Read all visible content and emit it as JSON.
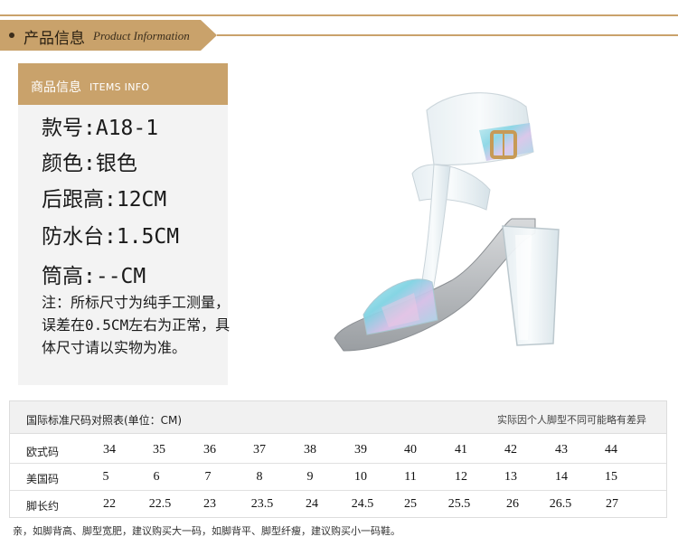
{
  "header": {
    "title_cn": "产品信息",
    "title_en": "Product Information"
  },
  "info_panel": {
    "title_cn": "商品信息",
    "title_en": "ITEMS INFO",
    "specs": [
      "款号:A18-1",
      "颜色:银色",
      "后跟高:12CM",
      "防水台:1.5CM",
      "筒高:--CM"
    ],
    "note": "注：所标尺寸为纯手工测量，误差在0.5CM左右为正常，具体尺寸请以实物为准。"
  },
  "size_table": {
    "title": "国际标准尺码对照表(单位：CM)",
    "note": "实际因个人脚型不同可能略有差异",
    "rows": [
      {
        "label": "欧式码",
        "values": [
          "34",
          "35",
          "36",
          "37",
          "38",
          "39",
          "40",
          "41",
          "42",
          "43",
          "44"
        ]
      },
      {
        "label": "美国码",
        "values": [
          "5",
          "6",
          "7",
          "8",
          "9",
          "10",
          "11",
          "12",
          "13",
          "14",
          "15"
        ]
      },
      {
        "label": "脚长约",
        "values": [
          "22",
          "22.5",
          "23",
          "23.5",
          "24",
          "24.5",
          "25",
          "25.5",
          "26",
          "26.5",
          "27"
        ]
      }
    ]
  },
  "footer": "亲，如脚背高、脚型宽肥，建议购买大一码，如脚背平、脚型纤瘦，建议购买小一码鞋。",
  "colors": {
    "accent": "#c9a26b",
    "panel_bg": "#f3f3f3"
  }
}
